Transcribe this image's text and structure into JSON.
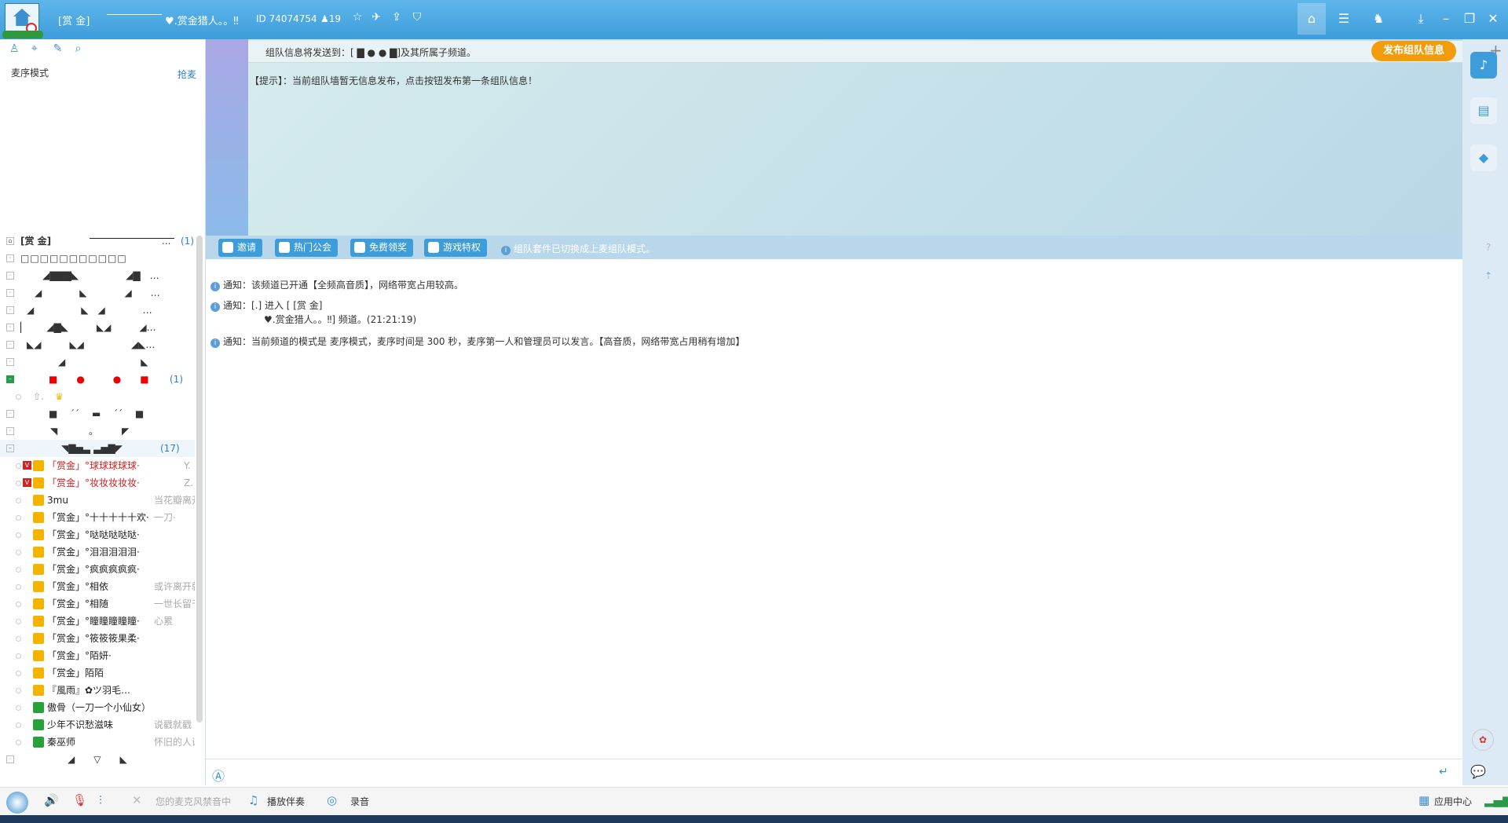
{
  "header": {
    "channel_name": "[赏 金]",
    "channel_sub": "♥.赏金猎人。。‼",
    "channel_id": "ID 74074754",
    "user_count": "19"
  },
  "left": {
    "mode_label": "麦序模式",
    "grab_mic": "抢麦",
    "tree": {
      "root_name": "[赏 金]",
      "root_suffix": "...",
      "root_count": "(1)",
      "sub1": "□□□□□□□□□□□",
      "group_red_count": "(1)",
      "group_main_count": "(17)",
      "users": [
        {
          "name": "「赏金」°球球球球球·",
          "sig": "Y."
        },
        {
          "name": "「赏金」°妆妆妆妆妆·",
          "sig": "Z."
        },
        {
          "name": "3mu",
          "sig": "当花瓣离开花朵，飘香何否"
        },
        {
          "name": "「赏金」°十十十十十欢·",
          "sig": "一刀·"
        },
        {
          "name": "「赏金」°哒哒哒哒哒·",
          "sig": ""
        },
        {
          "name": "「赏金」°泪泪泪泪泪·",
          "sig": ""
        },
        {
          "name": "「赏金」°疯疯疯疯疯·",
          "sig": ""
        },
        {
          "name": "「赏金」°相依",
          "sig": "或许离开就"
        },
        {
          "name": "「赏金」°相随",
          "sig": "一世长留千"
        },
        {
          "name": "「赏金」°瞳瞳瞳瞳瞳·",
          "sig": "心累"
        },
        {
          "name": "「赏金」°筱筱筱果柔·",
          "sig": ""
        },
        {
          "name": "「赏金」°陌妍·",
          "sig": ""
        },
        {
          "name": "「赏金」陌陌",
          "sig": ""
        },
        {
          "name": "『風雨』✿ツ羽毛…",
          "sig": ""
        },
        {
          "name": "傲骨（一刀一个小仙女）",
          "sig": ""
        },
        {
          "name": "少年不识愁滋味",
          "sig": "说戳就戳"
        },
        {
          "name": "秦巫师",
          "sig": "怀旧的人话的贷"
        }
      ]
    }
  },
  "top": {
    "send_to": "组队信息将发送到：[ ▇ ● ● ▇]及其所属子频道。",
    "publish_button": "发布组队信息",
    "tip": "【提示】：当前组队墙暂无信息发布，点击按钮发布第一条组队信息！"
  },
  "toolbar": {
    "invite": "邀请",
    "hot_guild": "热门公会",
    "free_prize": "免费领奖",
    "game_privilege": "游戏特权",
    "mode_notice": "组队套件已切换成上麦组队模式。"
  },
  "messages": {
    "m1": "通知：该频道已开通【全频高音质】，网络带宽占用较高。",
    "m2a": "通知：[.] 进入 [ [赏 金]",
    "m2b": "♥.赏金猎人。。‼] 频道。(21:21:19)",
    "m3": "通知：当前频道的模式是 麦序模式，麦序时间是 300 秒，麦序第一人和管理员可以发言。【高音质，网络带宽占用稍有增加】"
  },
  "bottom": {
    "mic_banned": "您的麦克风禁音中",
    "play_accompany": "播放伴奏",
    "record": "录音",
    "app_center": "应用中心"
  },
  "colors": {
    "accent": "#3d9ddb",
    "publish": "#f29b0d",
    "vip_red": "#d52020",
    "gold": "#f3b400"
  }
}
